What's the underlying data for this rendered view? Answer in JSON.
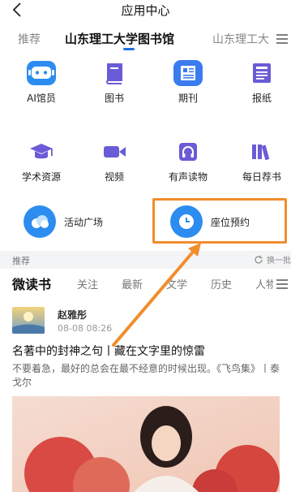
{
  "header": {
    "title": "应用中心"
  },
  "top_tabs": [
    {
      "label": "推荐",
      "active": false
    },
    {
      "label": "山东理工大学图书馆",
      "active": true
    },
    {
      "label": "山东理工大",
      "active": false
    }
  ],
  "grid": [
    {
      "label": "AI馆员",
      "icon": "robot-icon"
    },
    {
      "label": "图书",
      "icon": "book-icon"
    },
    {
      "label": "期刊",
      "icon": "journal-icon"
    },
    {
      "label": "报纸",
      "icon": "newspaper-icon"
    },
    {
      "label": "学术资源",
      "icon": "graduation-cap-icon"
    },
    {
      "label": "视频",
      "icon": "video-icon"
    },
    {
      "label": "有声读物",
      "icon": "headphones-icon"
    },
    {
      "label": "每日荐书",
      "icon": "books-icon"
    }
  ],
  "big_items": [
    {
      "label": "活动广场",
      "icon": "cloud-icon"
    },
    {
      "label": "座位预约",
      "icon": "clock-icon"
    }
  ],
  "recommend_bar": {
    "label": "推荐",
    "refresh_label": "换一批"
  },
  "sub_tabs": [
    {
      "label": "微读书",
      "active": true
    },
    {
      "label": "关注",
      "active": false
    },
    {
      "label": "最新",
      "active": false
    },
    {
      "label": "文学",
      "active": false
    },
    {
      "label": "历史",
      "active": false
    },
    {
      "label": "人物",
      "active": false
    }
  ],
  "post": {
    "author": "赵雅彤",
    "date": "08-08 08:26",
    "title": "名著中的封神之句丨藏在文字里的惊雷",
    "excerpt": "不要着急，最好的总会在最不经意的时候出现。《飞鸟集》丨泰戈尔"
  },
  "colors": {
    "accent": "#1f6fe5",
    "icon_blue": "#2d8cf0",
    "icon_purple": "#6a5bd6",
    "highlight": "#f08d2d"
  }
}
